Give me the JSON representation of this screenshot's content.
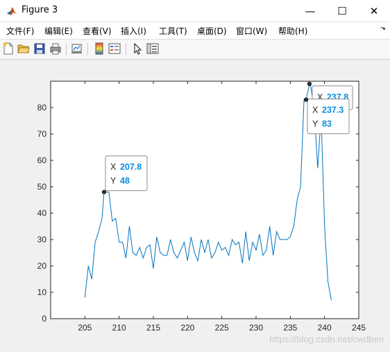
{
  "window": {
    "title": "Figure 3",
    "minimize_glyph": "—",
    "maximize_glyph": "☐",
    "close_glyph": "✕"
  },
  "menu": {
    "items": [
      {
        "label": "文件(F)"
      },
      {
        "label": "编辑(E)"
      },
      {
        "label": "查看(V)"
      },
      {
        "label": "插入(I)"
      },
      {
        "label": "工具(T)"
      },
      {
        "label": "桌面(D)"
      },
      {
        "label": "窗口(W)"
      },
      {
        "label": "帮助(H)"
      }
    ],
    "overflow_glyph": "⬎"
  },
  "toolbar": {
    "buttons": [
      {
        "icon": "new-figure-icon"
      },
      {
        "icon": "open-file-icon"
      },
      {
        "icon": "save-icon"
      },
      {
        "icon": "print-icon"
      },
      {
        "icon": "link-plot-icon"
      },
      {
        "icon": "colorbar-icon"
      },
      {
        "icon": "legend-icon"
      },
      {
        "icon": "edit-plot-icon"
      },
      {
        "icon": "property-inspector-icon"
      }
    ]
  },
  "chart_data": {
    "type": "line",
    "x": [
      205,
      205.5,
      206,
      206.5,
      207,
      207.5,
      207.8,
      208,
      208.5,
      209,
      209.5,
      210,
      210.5,
      211,
      211.5,
      212,
      212.5,
      213,
      213.5,
      214,
      214.5,
      215,
      215.5,
      216,
      216.5,
      217,
      217.5,
      218,
      218.5,
      219,
      219.5,
      220,
      220.5,
      221,
      221.5,
      222,
      222.5,
      223,
      223.5,
      224,
      224.5,
      225,
      225.5,
      226,
      226.5,
      227,
      227.5,
      228,
      228.5,
      229,
      229.5,
      230,
      230.5,
      231,
      231.5,
      232,
      232.5,
      233,
      233.5,
      234,
      234.5,
      235,
      235.5,
      236,
      236.5,
      237,
      237.3,
      237.8,
      238,
      238.5,
      239,
      239.5,
      240,
      240.5,
      241
    ],
    "y": [
      8,
      20,
      15,
      29,
      33,
      38,
      48,
      48,
      48,
      37,
      38,
      29,
      29,
      23,
      35,
      25,
      24,
      27,
      23,
      27,
      28,
      19,
      31,
      25,
      24,
      24,
      30,
      25,
      23,
      26,
      29,
      22,
      31,
      25,
      22,
      30,
      25,
      30,
      23,
      25,
      29,
      26,
      27,
      24,
      30,
      28,
      29,
      21,
      33,
      22,
      29,
      26,
      32,
      24,
      26,
      35,
      24,
      33,
      30,
      30,
      30,
      31,
      35,
      45,
      50,
      83,
      83,
      89,
      88,
      79,
      57,
      77,
      35,
      14,
      7
    ],
    "xlim": [
      200,
      245
    ],
    "ylim": [
      0,
      90
    ],
    "xticks": [
      205,
      210,
      215,
      220,
      225,
      230,
      235,
      240,
      245
    ],
    "yticks": [
      0,
      10,
      20,
      30,
      40,
      50,
      60,
      70,
      80
    ],
    "line_color": "#0072bd",
    "grid": false,
    "datatips": [
      {
        "x_label": "X",
        "x_value": "207.8",
        "y_label": "Y",
        "y_value": "48",
        "x": 207.8,
        "y": 48
      },
      {
        "x_label": "X",
        "x_value": "237.3",
        "y_label": "Y",
        "y_value": "83",
        "x": 237.3,
        "y": 83
      },
      {
        "x_label": "X",
        "x_value": "237.8",
        "x": 237.8,
        "y": 89
      }
    ]
  },
  "watermark": "https://blog.csdn.net/cwdben"
}
